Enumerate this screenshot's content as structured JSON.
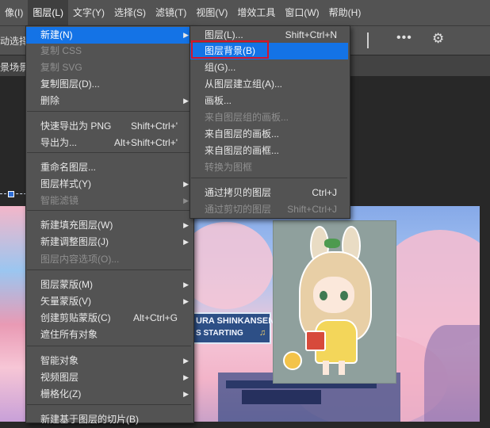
{
  "menubar": {
    "items": [
      {
        "label": "像(I)"
      },
      {
        "label": "图层(L)"
      },
      {
        "label": "文字(Y)"
      },
      {
        "label": "选择(S)"
      },
      {
        "label": "滤镜(T)"
      },
      {
        "label": "视图(V)"
      },
      {
        "label": "增效工具"
      },
      {
        "label": "窗口(W)"
      },
      {
        "label": "帮助(H)"
      }
    ]
  },
  "options_bar": {
    "left_text": "动选择",
    "more_label": "•••",
    "gear_label": "⚙"
  },
  "tab_bar": {
    "left_text": "景场景"
  },
  "canvas": {
    "sign_line1": "URA SHINKANSEN",
    "sign_line2": "S STARTING",
    "sign_note": "♫"
  },
  "layer_menu": {
    "items": [
      {
        "label": "新建(N)",
        "shortcut": "",
        "submenu": true,
        "disabled": false,
        "highlighted": true
      },
      {
        "label": "复制 CSS",
        "shortcut": "",
        "submenu": false,
        "disabled": true
      },
      {
        "label": "复制 SVG",
        "shortcut": "",
        "submenu": false,
        "disabled": true
      },
      {
        "label": "复制图层(D)...",
        "shortcut": "",
        "submenu": false,
        "disabled": false
      },
      {
        "label": "删除",
        "shortcut": "",
        "submenu": true,
        "disabled": false
      },
      {
        "label": "快速导出为 PNG",
        "shortcut": "Shift+Ctrl+'",
        "submenu": false,
        "disabled": false
      },
      {
        "label": "导出为...",
        "shortcut": "Alt+Shift+Ctrl+'",
        "submenu": false,
        "disabled": false
      },
      {
        "label": "重命名图层...",
        "shortcut": "",
        "submenu": false,
        "disabled": false
      },
      {
        "label": "图层样式(Y)",
        "shortcut": "",
        "submenu": true,
        "disabled": false
      },
      {
        "label": "智能滤镜",
        "shortcut": "",
        "submenu": true,
        "disabled": true
      },
      {
        "label": "新建填充图层(W)",
        "shortcut": "",
        "submenu": true,
        "disabled": false
      },
      {
        "label": "新建调整图层(J)",
        "shortcut": "",
        "submenu": true,
        "disabled": false
      },
      {
        "label": "图层内容选项(O)...",
        "shortcut": "",
        "submenu": false,
        "disabled": true
      },
      {
        "label": "图层蒙版(M)",
        "shortcut": "",
        "submenu": true,
        "disabled": false
      },
      {
        "label": "矢量蒙版(V)",
        "shortcut": "",
        "submenu": true,
        "disabled": false
      },
      {
        "label": "创建剪贴蒙版(C)",
        "shortcut": "Alt+Ctrl+G",
        "submenu": false,
        "disabled": false
      },
      {
        "label": "遮住所有对象",
        "shortcut": "",
        "submenu": false,
        "disabled": false
      },
      {
        "label": "智能对象",
        "shortcut": "",
        "submenu": true,
        "disabled": false
      },
      {
        "label": "视频图层",
        "shortcut": "",
        "submenu": true,
        "disabled": false
      },
      {
        "label": "栅格化(Z)",
        "shortcut": "",
        "submenu": true,
        "disabled": false
      },
      {
        "label": "新建基于图层的切片(B)",
        "shortcut": "",
        "submenu": false,
        "disabled": false
      }
    ]
  },
  "new_submenu": {
    "items": [
      {
        "label": "图层(L)...",
        "shortcut": "Shift+Ctrl+N",
        "disabled": false
      },
      {
        "label": "图层背景(B)",
        "shortcut": "",
        "disabled": false,
        "highlighted": true
      },
      {
        "label": "组(G)...",
        "shortcut": "",
        "disabled": false
      },
      {
        "label": "从图层建立组(A)...",
        "shortcut": "",
        "disabled": false
      },
      {
        "label": "画板...",
        "shortcut": "",
        "disabled": false
      },
      {
        "label": "来自图层组的画板...",
        "shortcut": "",
        "disabled": true
      },
      {
        "label": "来自图层的画板...",
        "shortcut": "",
        "disabled": false
      },
      {
        "label": "来自图层的画框...",
        "shortcut": "",
        "disabled": false
      },
      {
        "label": "转换为图框",
        "shortcut": "",
        "disabled": true
      },
      {
        "label": "通过拷贝的图层",
        "shortcut": "Ctrl+J",
        "disabled": false
      },
      {
        "label": "通过剪切的图层",
        "shortcut": "Shift+Ctrl+J",
        "disabled": true
      }
    ]
  },
  "colors": {
    "highlight": "#1473e6",
    "menu_bg": "#535353",
    "annotation_box": "#d4142a"
  }
}
